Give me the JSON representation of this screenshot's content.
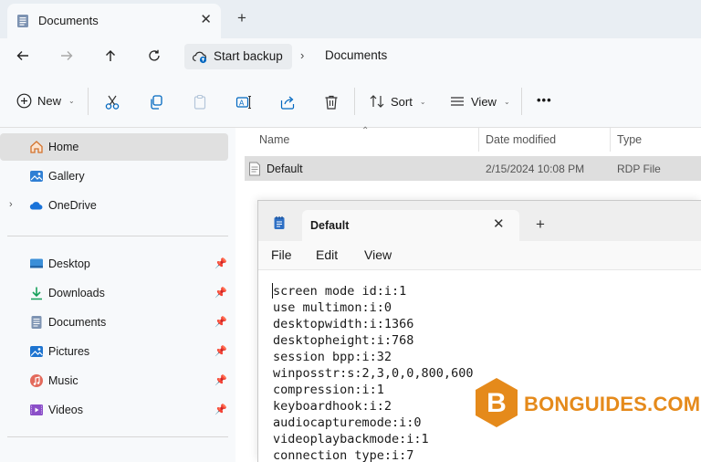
{
  "explorer": {
    "tab": {
      "title": "Documents"
    },
    "address": {
      "backup_label": "Start backup",
      "current": "Documents"
    },
    "toolbar": {
      "new_label": "New",
      "sort_label": "Sort",
      "view_label": "View",
      "more": "•••"
    },
    "sidebar": {
      "top": [
        {
          "label": "Home",
          "icon": "home-icon",
          "selected": true
        },
        {
          "label": "Gallery",
          "icon": "gallery-icon"
        },
        {
          "label": "OneDrive",
          "icon": "cloud-icon"
        }
      ],
      "pinned": [
        {
          "label": "Desktop",
          "icon": "desktop-icon"
        },
        {
          "label": "Downloads",
          "icon": "download-icon"
        },
        {
          "label": "Documents",
          "icon": "document-icon"
        },
        {
          "label": "Pictures",
          "icon": "pictures-icon"
        },
        {
          "label": "Music",
          "icon": "music-icon"
        },
        {
          "label": "Videos",
          "icon": "video-icon"
        }
      ]
    },
    "columns": {
      "name": "Name",
      "date": "Date modified",
      "type": "Type"
    },
    "files": [
      {
        "name": "Default",
        "date": "2/15/2024 10:08 PM",
        "type": "RDP File",
        "selected": true
      }
    ]
  },
  "notepad": {
    "tab_title": "Default",
    "menu": {
      "file": "File",
      "edit": "Edit",
      "view": "View"
    },
    "lines": [
      "screen mode id:i:1",
      "use multimon:i:0",
      "desktopwidth:i:1366",
      "desktopheight:i:768",
      "session bpp:i:32",
      "winposstr:s:2,3,0,0,800,600",
      "compression:i:1",
      "keyboardhook:i:2",
      "audiocapturemode:i:0",
      "videoplaybackmode:i:1",
      "connection type:i:7"
    ]
  },
  "watermark": {
    "letter": "B",
    "text": "BONGUIDES.COM"
  },
  "colors": {
    "accent": "#0067c0",
    "watermark": "#e58a1b",
    "selection": "#dedede"
  }
}
